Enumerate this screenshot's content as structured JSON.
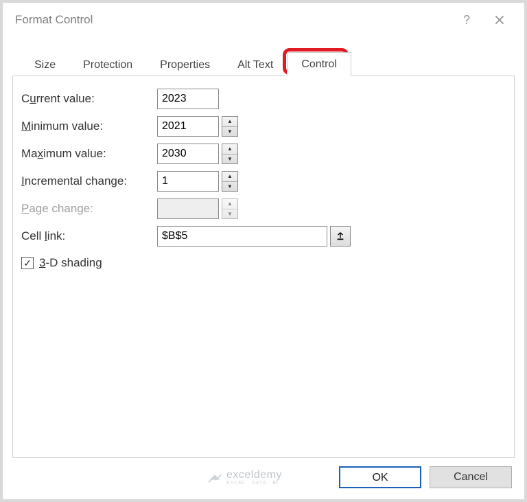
{
  "window": {
    "title": "Format Control"
  },
  "tabs": [
    {
      "label": "Size"
    },
    {
      "label": "Protection"
    },
    {
      "label": "Properties"
    },
    {
      "label": "Alt Text"
    },
    {
      "label": "Control",
      "active": true
    }
  ],
  "fields": {
    "current_value": {
      "label_pre": "C",
      "label_u": "u",
      "label_post": "rrent value:",
      "value": "2023"
    },
    "minimum_value": {
      "label_pre": "",
      "label_u": "M",
      "label_post": "inimum value:",
      "value": "2021"
    },
    "maximum_value": {
      "label_pre": "Ma",
      "label_u": "x",
      "label_post": "imum value:",
      "value": "2030"
    },
    "incremental_change": {
      "label_pre": "",
      "label_u": "I",
      "label_post": "ncremental change:",
      "value": "1"
    },
    "page_change": {
      "label_pre": "",
      "label_u": "P",
      "label_post": "age change:",
      "value": ""
    },
    "cell_link": {
      "label_pre": "Cell ",
      "label_u": "l",
      "label_post": "ink:",
      "value": "$B$5"
    }
  },
  "shading": {
    "label_pre": "",
    "label_u": "3",
    "label_post": "-D shading",
    "checked": true
  },
  "buttons": {
    "ok": "OK",
    "cancel": "Cancel"
  },
  "watermark": {
    "main": "exceldemy",
    "sub": "EXCEL · DATA · BI"
  }
}
